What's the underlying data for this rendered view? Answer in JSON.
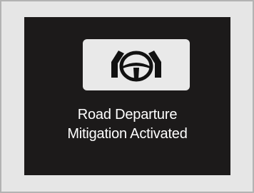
{
  "notification": {
    "icon": "road-departure-steering-icon",
    "line1": "Road Departure",
    "line2": "Mitigation Activated"
  },
  "colors": {
    "background": "#e6e6e6",
    "screen": "#1c1a1a",
    "icon_tile": "#e9e9e9",
    "text": "#ffffff"
  }
}
